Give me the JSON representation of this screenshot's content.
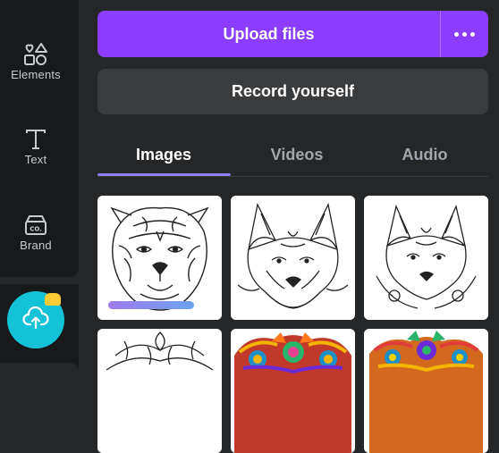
{
  "sidebar": {
    "items": [
      {
        "label": "Elements",
        "icon": "elements-icon"
      },
      {
        "label": "Text",
        "icon": "text-icon"
      },
      {
        "label": "Brand",
        "icon": "brand-icon"
      }
    ],
    "upload_icon": "cloud-upload-icon"
  },
  "actions": {
    "upload_label": "Upload files",
    "more_icon": "more-dots-icon",
    "record_label": "Record yourself"
  },
  "tabs": [
    {
      "label": "Images",
      "active": true
    },
    {
      "label": "Videos",
      "active": false
    },
    {
      "label": "Audio",
      "active": false
    }
  ],
  "thumbnails": [
    {
      "subject": "tiger-mandala-lineart",
      "upload_progress": 0.7
    },
    {
      "subject": "fox-mandala-lineart"
    },
    {
      "subject": "fox-mandala-lineart-2"
    },
    {
      "subject": "lion-mandala-lineart"
    },
    {
      "subject": "colorful-mandala-animal"
    },
    {
      "subject": "colorful-mandala-animal-2"
    }
  ],
  "colors": {
    "accent": "#8b3dff",
    "fab": "#13c2d6",
    "tab_underline": "#8b7cf8"
  }
}
